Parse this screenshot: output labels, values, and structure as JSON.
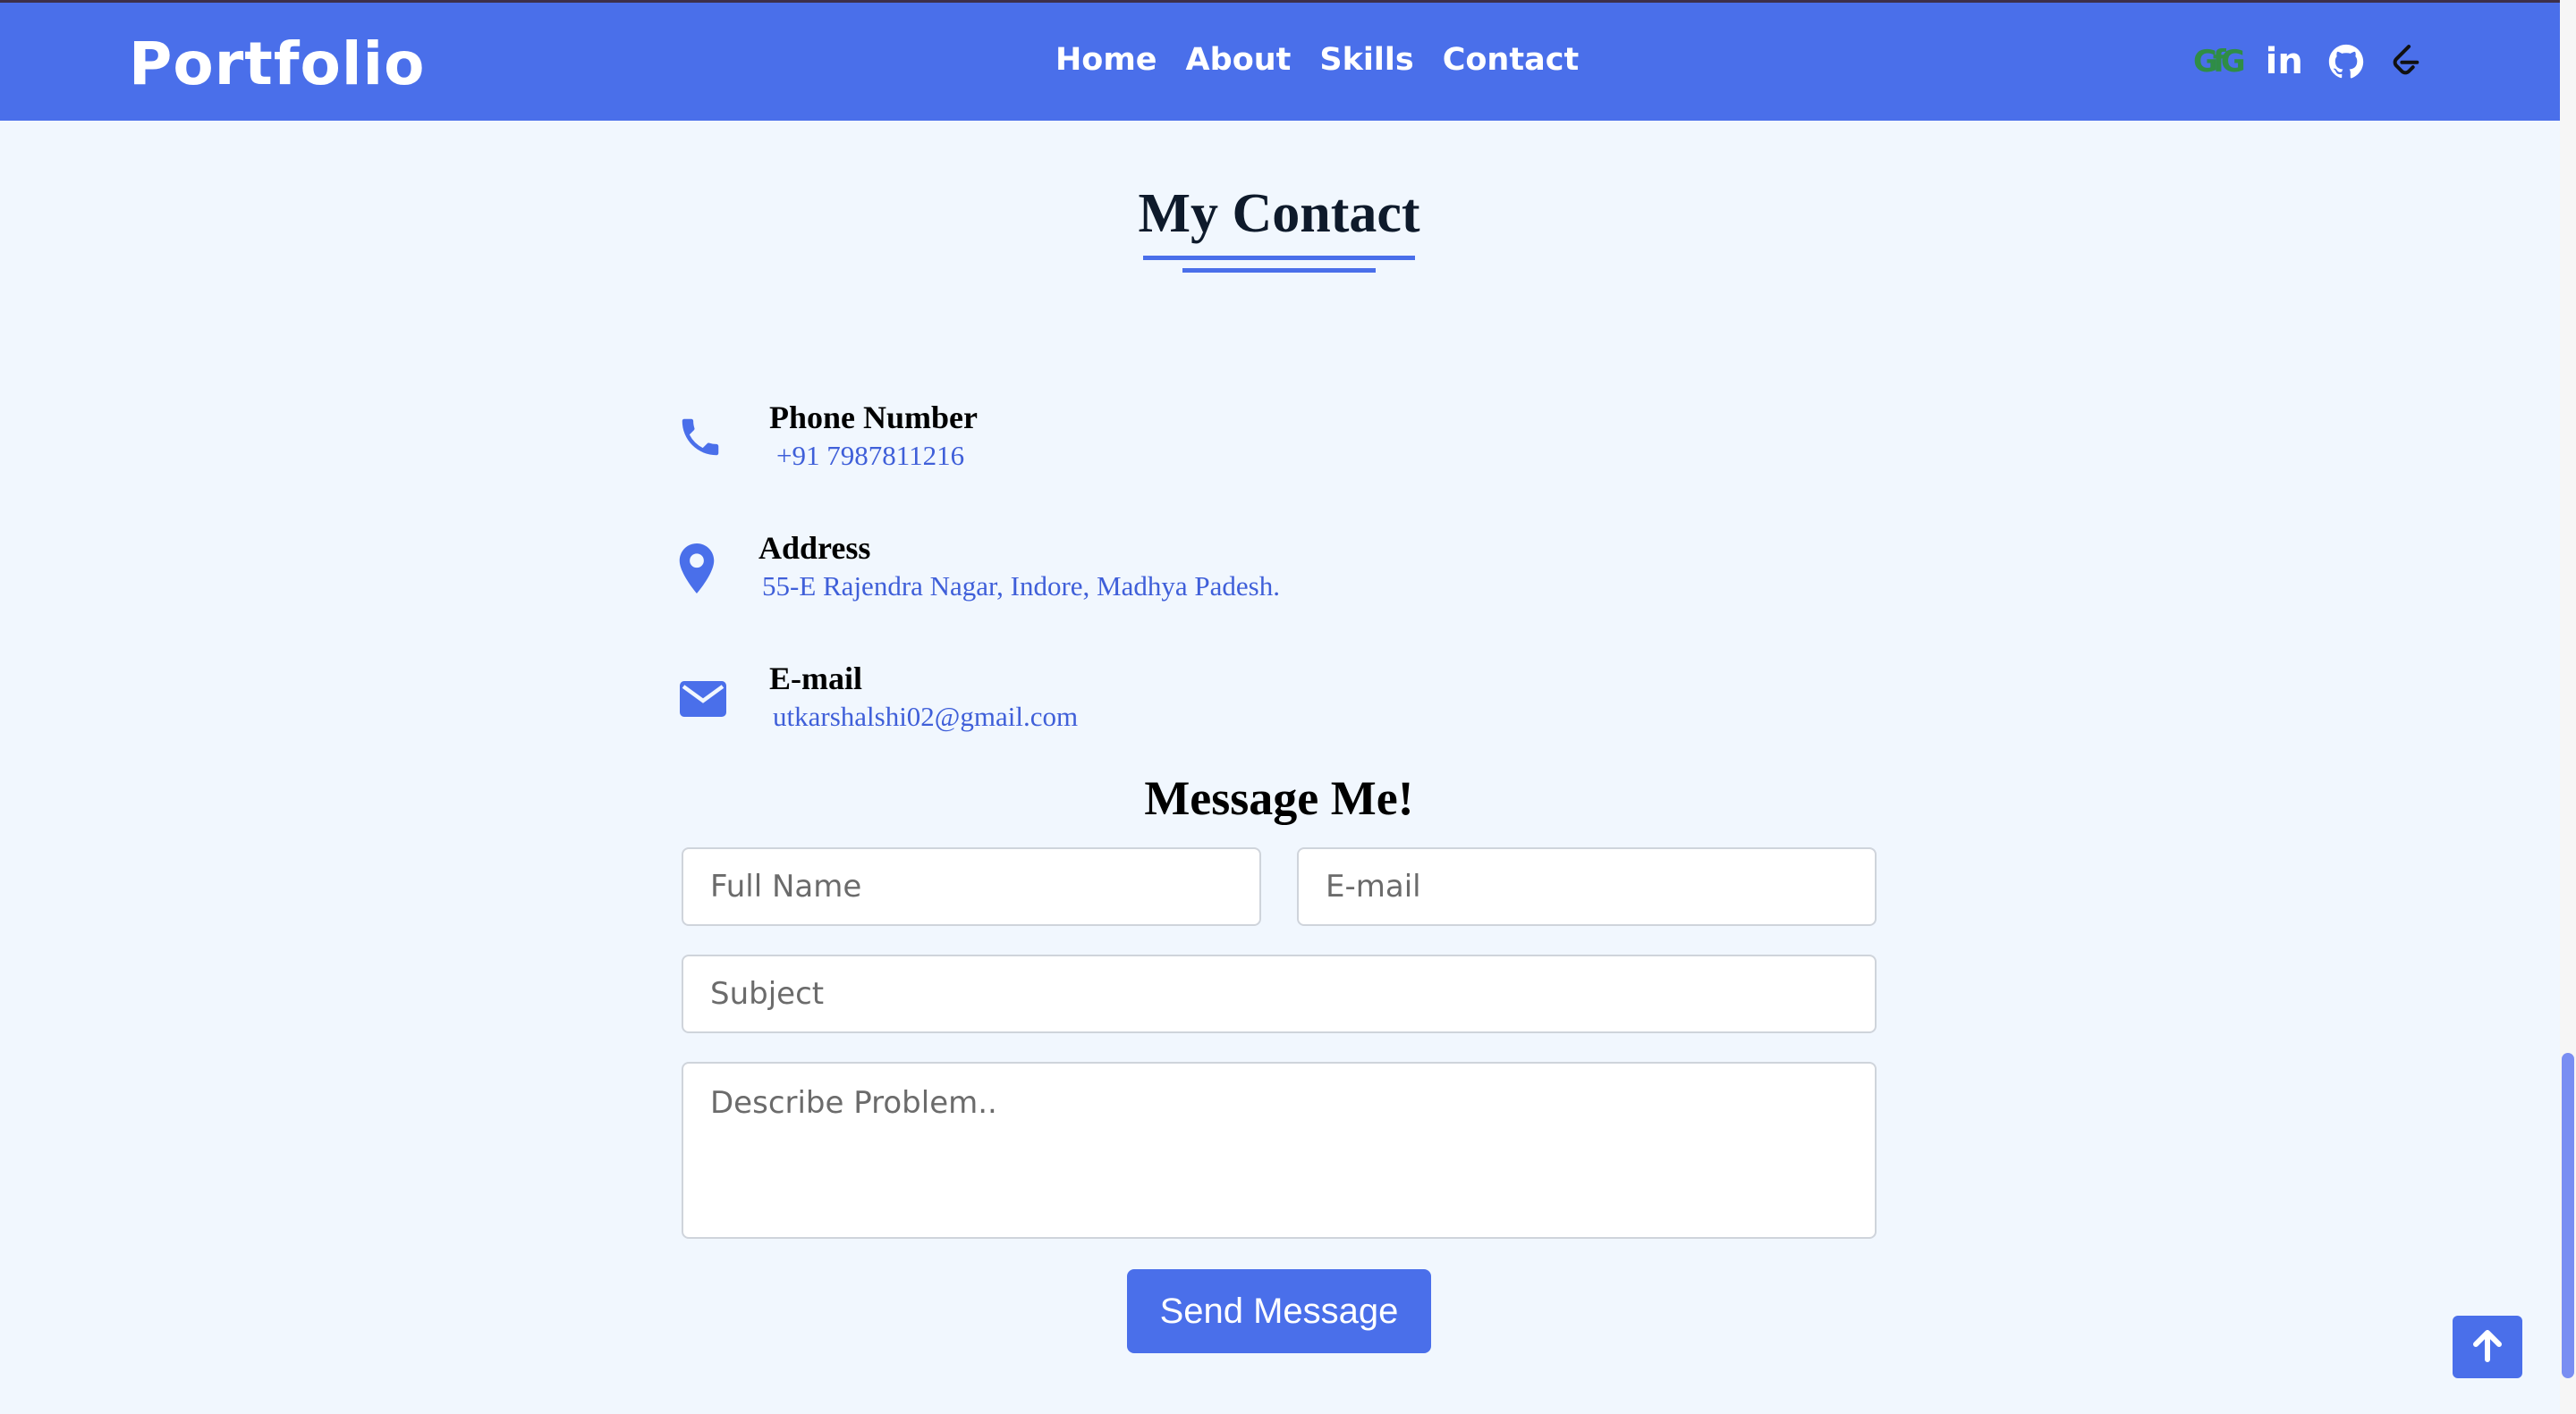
{
  "brand": "Portfolio",
  "nav": {
    "links": [
      "Home",
      "About",
      "Skills",
      "Contact"
    ]
  },
  "social": {
    "gfg": "GfG",
    "linkedin": "in",
    "icons": [
      "geeksforgeeks-icon",
      "linkedin-icon",
      "github-icon",
      "leetcode-icon"
    ]
  },
  "contact": {
    "title": "My Contact",
    "phone": {
      "label": "Phone Number",
      "value": "+91 7987811216"
    },
    "address": {
      "label": "Address",
      "value": "55-E Rajendra Nagar, Indore, Madhya Padesh."
    },
    "email": {
      "label": "E-mail",
      "value": "utkarshalshi02@gmail.com"
    }
  },
  "form": {
    "title": "Message Me!",
    "name_placeholder": "Full Name",
    "email_placeholder": "E-mail",
    "subject_placeholder": "Subject",
    "message_placeholder": "Describe Problem..",
    "submit_label": "Send Message"
  },
  "colors": {
    "accent": "#4a6fea",
    "background": "#f1f7fe",
    "link": "#3f5fd9",
    "gfg": "#2f8d46"
  }
}
